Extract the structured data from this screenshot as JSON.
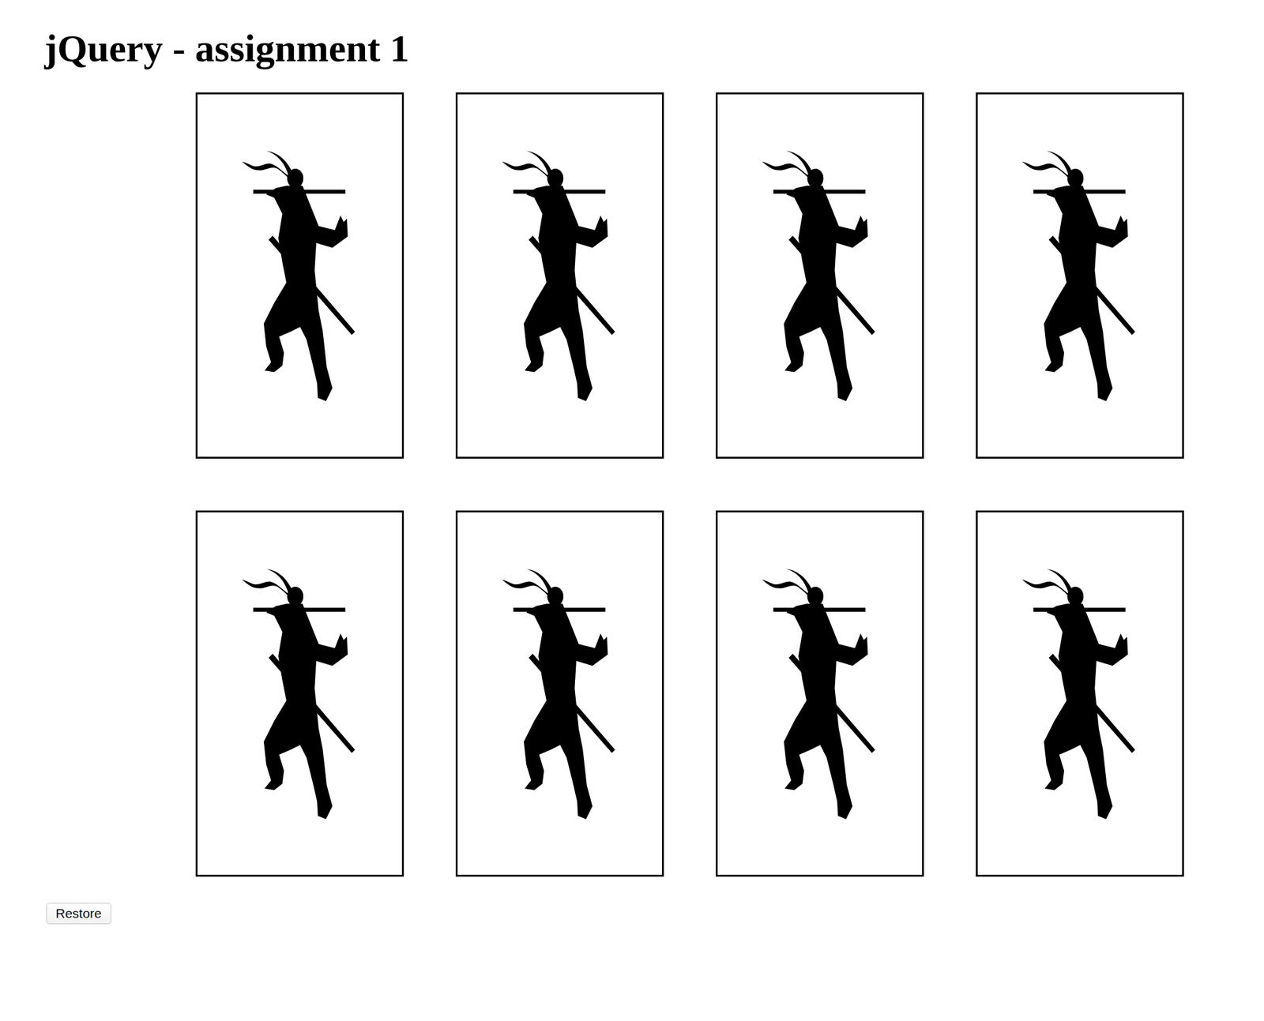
{
  "title": "jQuery - assignment 1",
  "cards": [
    {},
    {},
    {},
    {},
    {},
    {},
    {},
    {}
  ],
  "buttons": [
    "Restore"
  ]
}
